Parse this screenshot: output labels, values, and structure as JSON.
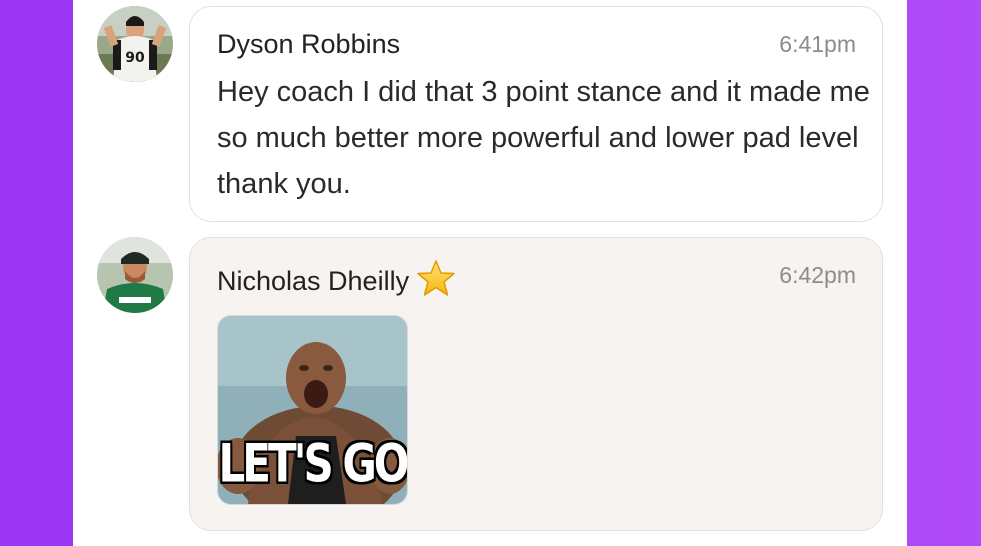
{
  "messages": [
    {
      "sender": "Dyson Robbins",
      "time": "6:41pm",
      "text": "Hey coach I did that 3 point stance and it made me so much better more powerful and lower pad level thank you.",
      "avatar_icon": "football-player-avatar-icon"
    },
    {
      "sender": "Nicholas Dheilly",
      "time": "6:42pm",
      "badge_icon": "star-icon",
      "gif_caption": "LET'S GO",
      "avatar_icon": "football-player-avatar-icon"
    }
  ],
  "colors": {
    "background_gradient_start": "#9b34f3",
    "background_gradient_end": "#b04bf8",
    "bubble_plain": "#ffffff",
    "bubble_tinted": "#f6f3f1",
    "timestamp": "#8c8c8c"
  }
}
